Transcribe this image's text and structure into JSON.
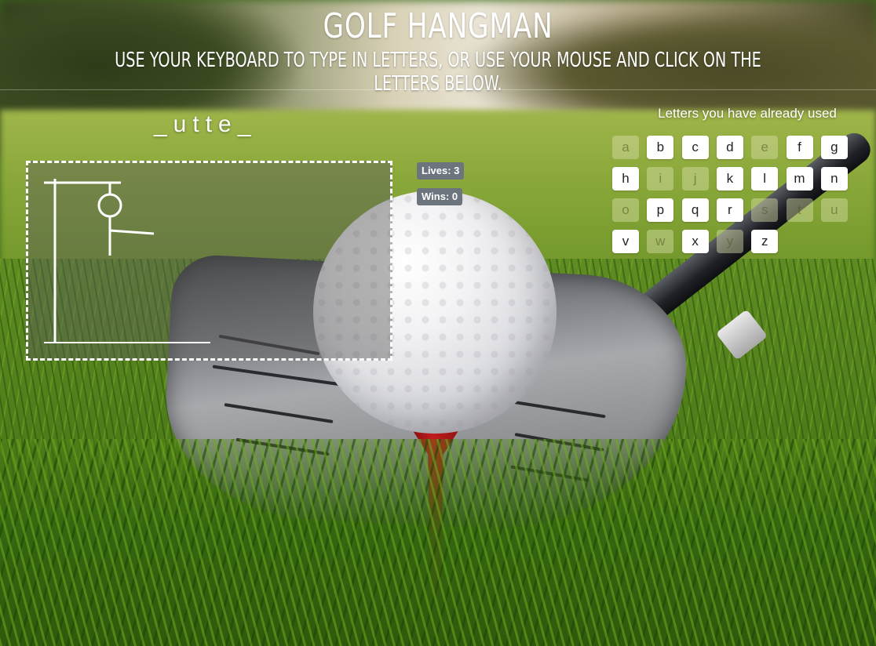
{
  "header": {
    "title": "GOLF HANGMAN",
    "subtitle": "USE YOUR KEYBOARD TO TYPE IN LETTERS, OR USE YOUR MOUSE AND CLICK ON THE LETTERS BELOW."
  },
  "game": {
    "word_display": "_utte_",
    "lives_label": "Lives: 3",
    "wins_label": "Wins: 0",
    "used_letters_title": "Letters you have already used"
  },
  "keyboard": {
    "keys": [
      {
        "letter": "a",
        "used": true
      },
      {
        "letter": "b",
        "used": false
      },
      {
        "letter": "c",
        "used": false
      },
      {
        "letter": "d",
        "used": false
      },
      {
        "letter": "e",
        "used": true
      },
      {
        "letter": "f",
        "used": false
      },
      {
        "letter": "g",
        "used": false
      },
      {
        "letter": "h",
        "used": false
      },
      {
        "letter": "i",
        "used": true
      },
      {
        "letter": "j",
        "used": true
      },
      {
        "letter": "k",
        "used": false
      },
      {
        "letter": "l",
        "used": false
      },
      {
        "letter": "m",
        "used": false
      },
      {
        "letter": "n",
        "used": false
      },
      {
        "letter": "o",
        "used": true
      },
      {
        "letter": "p",
        "used": false
      },
      {
        "letter": "q",
        "used": false
      },
      {
        "letter": "r",
        "used": false
      },
      {
        "letter": "s",
        "used": true
      },
      {
        "letter": "t",
        "used": true
      },
      {
        "letter": "u",
        "used": true
      },
      {
        "letter": "v",
        "used": false
      },
      {
        "letter": "w",
        "used": true
      },
      {
        "letter": "x",
        "used": false
      },
      {
        "letter": "y",
        "used": true
      },
      {
        "letter": "z",
        "used": false
      }
    ]
  },
  "hangman": {
    "parts_shown": [
      "gallows",
      "head",
      "body",
      "arm"
    ]
  },
  "colors": {
    "badge": "#6c757d",
    "key_bg": "#ffffff",
    "text": "#ffffff"
  }
}
